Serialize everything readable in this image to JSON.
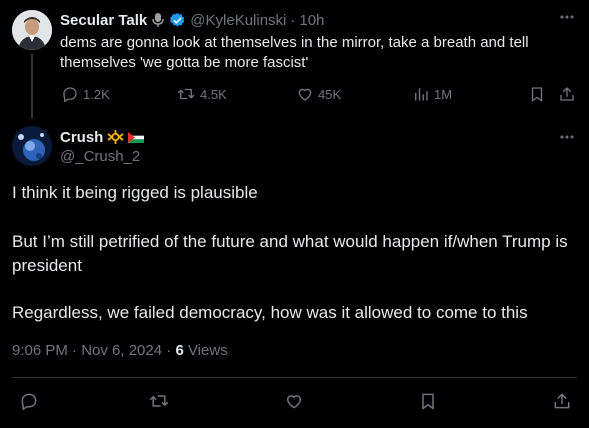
{
  "parent_tweet": {
    "display_name": "Secular Talk",
    "handle": "@KyleKulinski",
    "separator": "·",
    "time": "10h",
    "text": "dems are gonna look at themselves in the mirror, take a breath and tell themselves 'we gotta be more fascist'",
    "stats": {
      "replies": "1.2K",
      "retweets": "4.5K",
      "likes": "45K",
      "views": "1M"
    }
  },
  "reply_tweet": {
    "display_name": "Crush",
    "handle": "@_Crush_2",
    "paragraphs": [
      "I think it being rigged is plausible",
      "But I’m still petrified of the future and what would happen if/when Trump is president",
      "Regardless, we failed democracy, how was it allowed to come to this"
    ],
    "timestamp": "9:06 PM · Nov 6, 2024",
    "meta_separator": " · ",
    "views_count": "6",
    "views_label": "Views"
  },
  "icons": {
    "verified": "verified-badge-icon",
    "microphone": "microphone-icon",
    "more": "more-icon",
    "reply": "reply-icon",
    "retweet": "retweet-icon",
    "like": "like-icon",
    "views": "views-icon",
    "bookmark": "bookmark-icon",
    "share": "share-icon"
  },
  "colors": {
    "background": "#000000",
    "text": "#e7e9ea",
    "muted": "#71767b",
    "verified": "#1d9bf0",
    "divider": "#2f3336"
  }
}
